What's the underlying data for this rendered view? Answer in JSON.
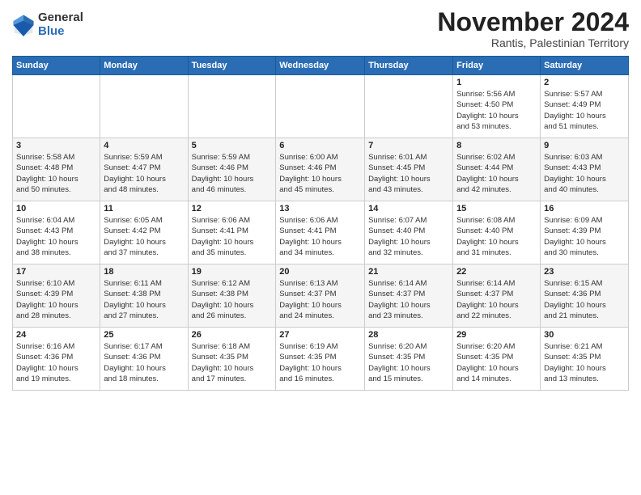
{
  "logo": {
    "general": "General",
    "blue": "Blue"
  },
  "title": "November 2024",
  "location": "Rantis, Palestinian Territory",
  "days_header": [
    "Sunday",
    "Monday",
    "Tuesday",
    "Wednesday",
    "Thursday",
    "Friday",
    "Saturday"
  ],
  "weeks": [
    [
      {
        "day": "",
        "info": ""
      },
      {
        "day": "",
        "info": ""
      },
      {
        "day": "",
        "info": ""
      },
      {
        "day": "",
        "info": ""
      },
      {
        "day": "",
        "info": ""
      },
      {
        "day": "1",
        "info": "Sunrise: 5:56 AM\nSunset: 4:50 PM\nDaylight: 10 hours\nand 53 minutes."
      },
      {
        "day": "2",
        "info": "Sunrise: 5:57 AM\nSunset: 4:49 PM\nDaylight: 10 hours\nand 51 minutes."
      }
    ],
    [
      {
        "day": "3",
        "info": "Sunrise: 5:58 AM\nSunset: 4:48 PM\nDaylight: 10 hours\nand 50 minutes."
      },
      {
        "day": "4",
        "info": "Sunrise: 5:59 AM\nSunset: 4:47 PM\nDaylight: 10 hours\nand 48 minutes."
      },
      {
        "day": "5",
        "info": "Sunrise: 5:59 AM\nSunset: 4:46 PM\nDaylight: 10 hours\nand 46 minutes."
      },
      {
        "day": "6",
        "info": "Sunrise: 6:00 AM\nSunset: 4:46 PM\nDaylight: 10 hours\nand 45 minutes."
      },
      {
        "day": "7",
        "info": "Sunrise: 6:01 AM\nSunset: 4:45 PM\nDaylight: 10 hours\nand 43 minutes."
      },
      {
        "day": "8",
        "info": "Sunrise: 6:02 AM\nSunset: 4:44 PM\nDaylight: 10 hours\nand 42 minutes."
      },
      {
        "day": "9",
        "info": "Sunrise: 6:03 AM\nSunset: 4:43 PM\nDaylight: 10 hours\nand 40 minutes."
      }
    ],
    [
      {
        "day": "10",
        "info": "Sunrise: 6:04 AM\nSunset: 4:43 PM\nDaylight: 10 hours\nand 38 minutes."
      },
      {
        "day": "11",
        "info": "Sunrise: 6:05 AM\nSunset: 4:42 PM\nDaylight: 10 hours\nand 37 minutes."
      },
      {
        "day": "12",
        "info": "Sunrise: 6:06 AM\nSunset: 4:41 PM\nDaylight: 10 hours\nand 35 minutes."
      },
      {
        "day": "13",
        "info": "Sunrise: 6:06 AM\nSunset: 4:41 PM\nDaylight: 10 hours\nand 34 minutes."
      },
      {
        "day": "14",
        "info": "Sunrise: 6:07 AM\nSunset: 4:40 PM\nDaylight: 10 hours\nand 32 minutes."
      },
      {
        "day": "15",
        "info": "Sunrise: 6:08 AM\nSunset: 4:40 PM\nDaylight: 10 hours\nand 31 minutes."
      },
      {
        "day": "16",
        "info": "Sunrise: 6:09 AM\nSunset: 4:39 PM\nDaylight: 10 hours\nand 30 minutes."
      }
    ],
    [
      {
        "day": "17",
        "info": "Sunrise: 6:10 AM\nSunset: 4:39 PM\nDaylight: 10 hours\nand 28 minutes."
      },
      {
        "day": "18",
        "info": "Sunrise: 6:11 AM\nSunset: 4:38 PM\nDaylight: 10 hours\nand 27 minutes."
      },
      {
        "day": "19",
        "info": "Sunrise: 6:12 AM\nSunset: 4:38 PM\nDaylight: 10 hours\nand 26 minutes."
      },
      {
        "day": "20",
        "info": "Sunrise: 6:13 AM\nSunset: 4:37 PM\nDaylight: 10 hours\nand 24 minutes."
      },
      {
        "day": "21",
        "info": "Sunrise: 6:14 AM\nSunset: 4:37 PM\nDaylight: 10 hours\nand 23 minutes."
      },
      {
        "day": "22",
        "info": "Sunrise: 6:14 AM\nSunset: 4:37 PM\nDaylight: 10 hours\nand 22 minutes."
      },
      {
        "day": "23",
        "info": "Sunrise: 6:15 AM\nSunset: 4:36 PM\nDaylight: 10 hours\nand 21 minutes."
      }
    ],
    [
      {
        "day": "24",
        "info": "Sunrise: 6:16 AM\nSunset: 4:36 PM\nDaylight: 10 hours\nand 19 minutes."
      },
      {
        "day": "25",
        "info": "Sunrise: 6:17 AM\nSunset: 4:36 PM\nDaylight: 10 hours\nand 18 minutes."
      },
      {
        "day": "26",
        "info": "Sunrise: 6:18 AM\nSunset: 4:35 PM\nDaylight: 10 hours\nand 17 minutes."
      },
      {
        "day": "27",
        "info": "Sunrise: 6:19 AM\nSunset: 4:35 PM\nDaylight: 10 hours\nand 16 minutes."
      },
      {
        "day": "28",
        "info": "Sunrise: 6:20 AM\nSunset: 4:35 PM\nDaylight: 10 hours\nand 15 minutes."
      },
      {
        "day": "29",
        "info": "Sunrise: 6:20 AM\nSunset: 4:35 PM\nDaylight: 10 hours\nand 14 minutes."
      },
      {
        "day": "30",
        "info": "Sunrise: 6:21 AM\nSunset: 4:35 PM\nDaylight: 10 hours\nand 13 minutes."
      }
    ]
  ]
}
